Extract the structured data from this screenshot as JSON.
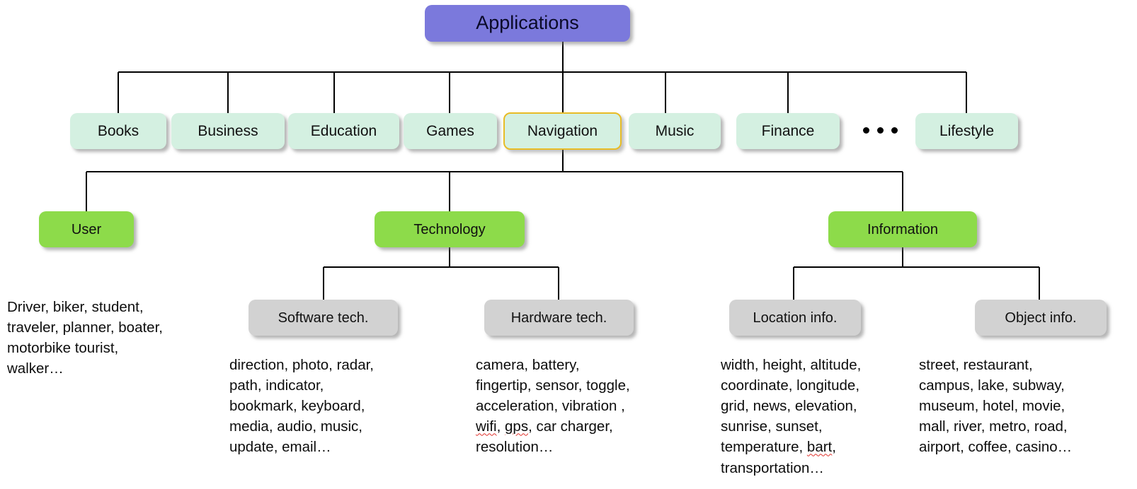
{
  "diagram": {
    "title_node": {
      "label": "Applications",
      "color": "#7b79dc"
    },
    "categories": [
      {
        "label": "Books",
        "selected": false
      },
      {
        "label": "Business",
        "selected": false
      },
      {
        "label": "Education",
        "selected": false
      },
      {
        "label": "Games",
        "selected": false
      },
      {
        "label": "Navigation",
        "selected": true
      },
      {
        "label": "Music",
        "selected": false
      },
      {
        "label": "Finance",
        "selected": false
      },
      {
        "label": "Lifestyle",
        "selected": false
      }
    ],
    "ellipsis": "• • •",
    "branches": [
      {
        "label": "User",
        "color": "#8ddb4a"
      },
      {
        "label": "Technology",
        "color": "#8ddb4a"
      },
      {
        "label": "Information",
        "color": "#8ddb4a"
      }
    ],
    "subbranches": [
      {
        "label": "Software tech.",
        "color": "#d2d2d2"
      },
      {
        "label": "Hardware tech.",
        "color": "#d2d2d2"
      },
      {
        "label": "Location info.",
        "color": "#d2d2d2"
      },
      {
        "label": "Object info.",
        "color": "#d2d2d2"
      }
    ],
    "leaf_lists": {
      "user": "Driver, biker, student,\ntraveler, planner, boater,\nmotorbike tourist,\nwalker…",
      "software_tech": "direction, photo, radar,\npath, indicator,\nbookmark, keyboard,\nmedia, audio, music,\nupdate, email…",
      "hardware_tech_pre": "camera, battery,\nfingertip, sensor, toggle,\nacceleration, vibration ,\n",
      "hardware_tech_misspell_1": "wifi",
      "hardware_tech_mid": ", ",
      "hardware_tech_misspell_2": "gps",
      "hardware_tech_post": ", car charger,\nresolution…",
      "location_info_pre": "width, height, altitude,\ncoordinate, longitude,\ngrid, news, elevation,\nsunrise, sunset,\ntemperature, ",
      "location_info_misspell": "bart",
      "location_info_post": ",\ntransportation…",
      "object_info": "street, restaurant,\ncampus, lake, subway,\nmuseum, hotel, movie,\nmall, river, metro, road,\nairport, coffee, casino…"
    },
    "edge_color": "#000000"
  }
}
